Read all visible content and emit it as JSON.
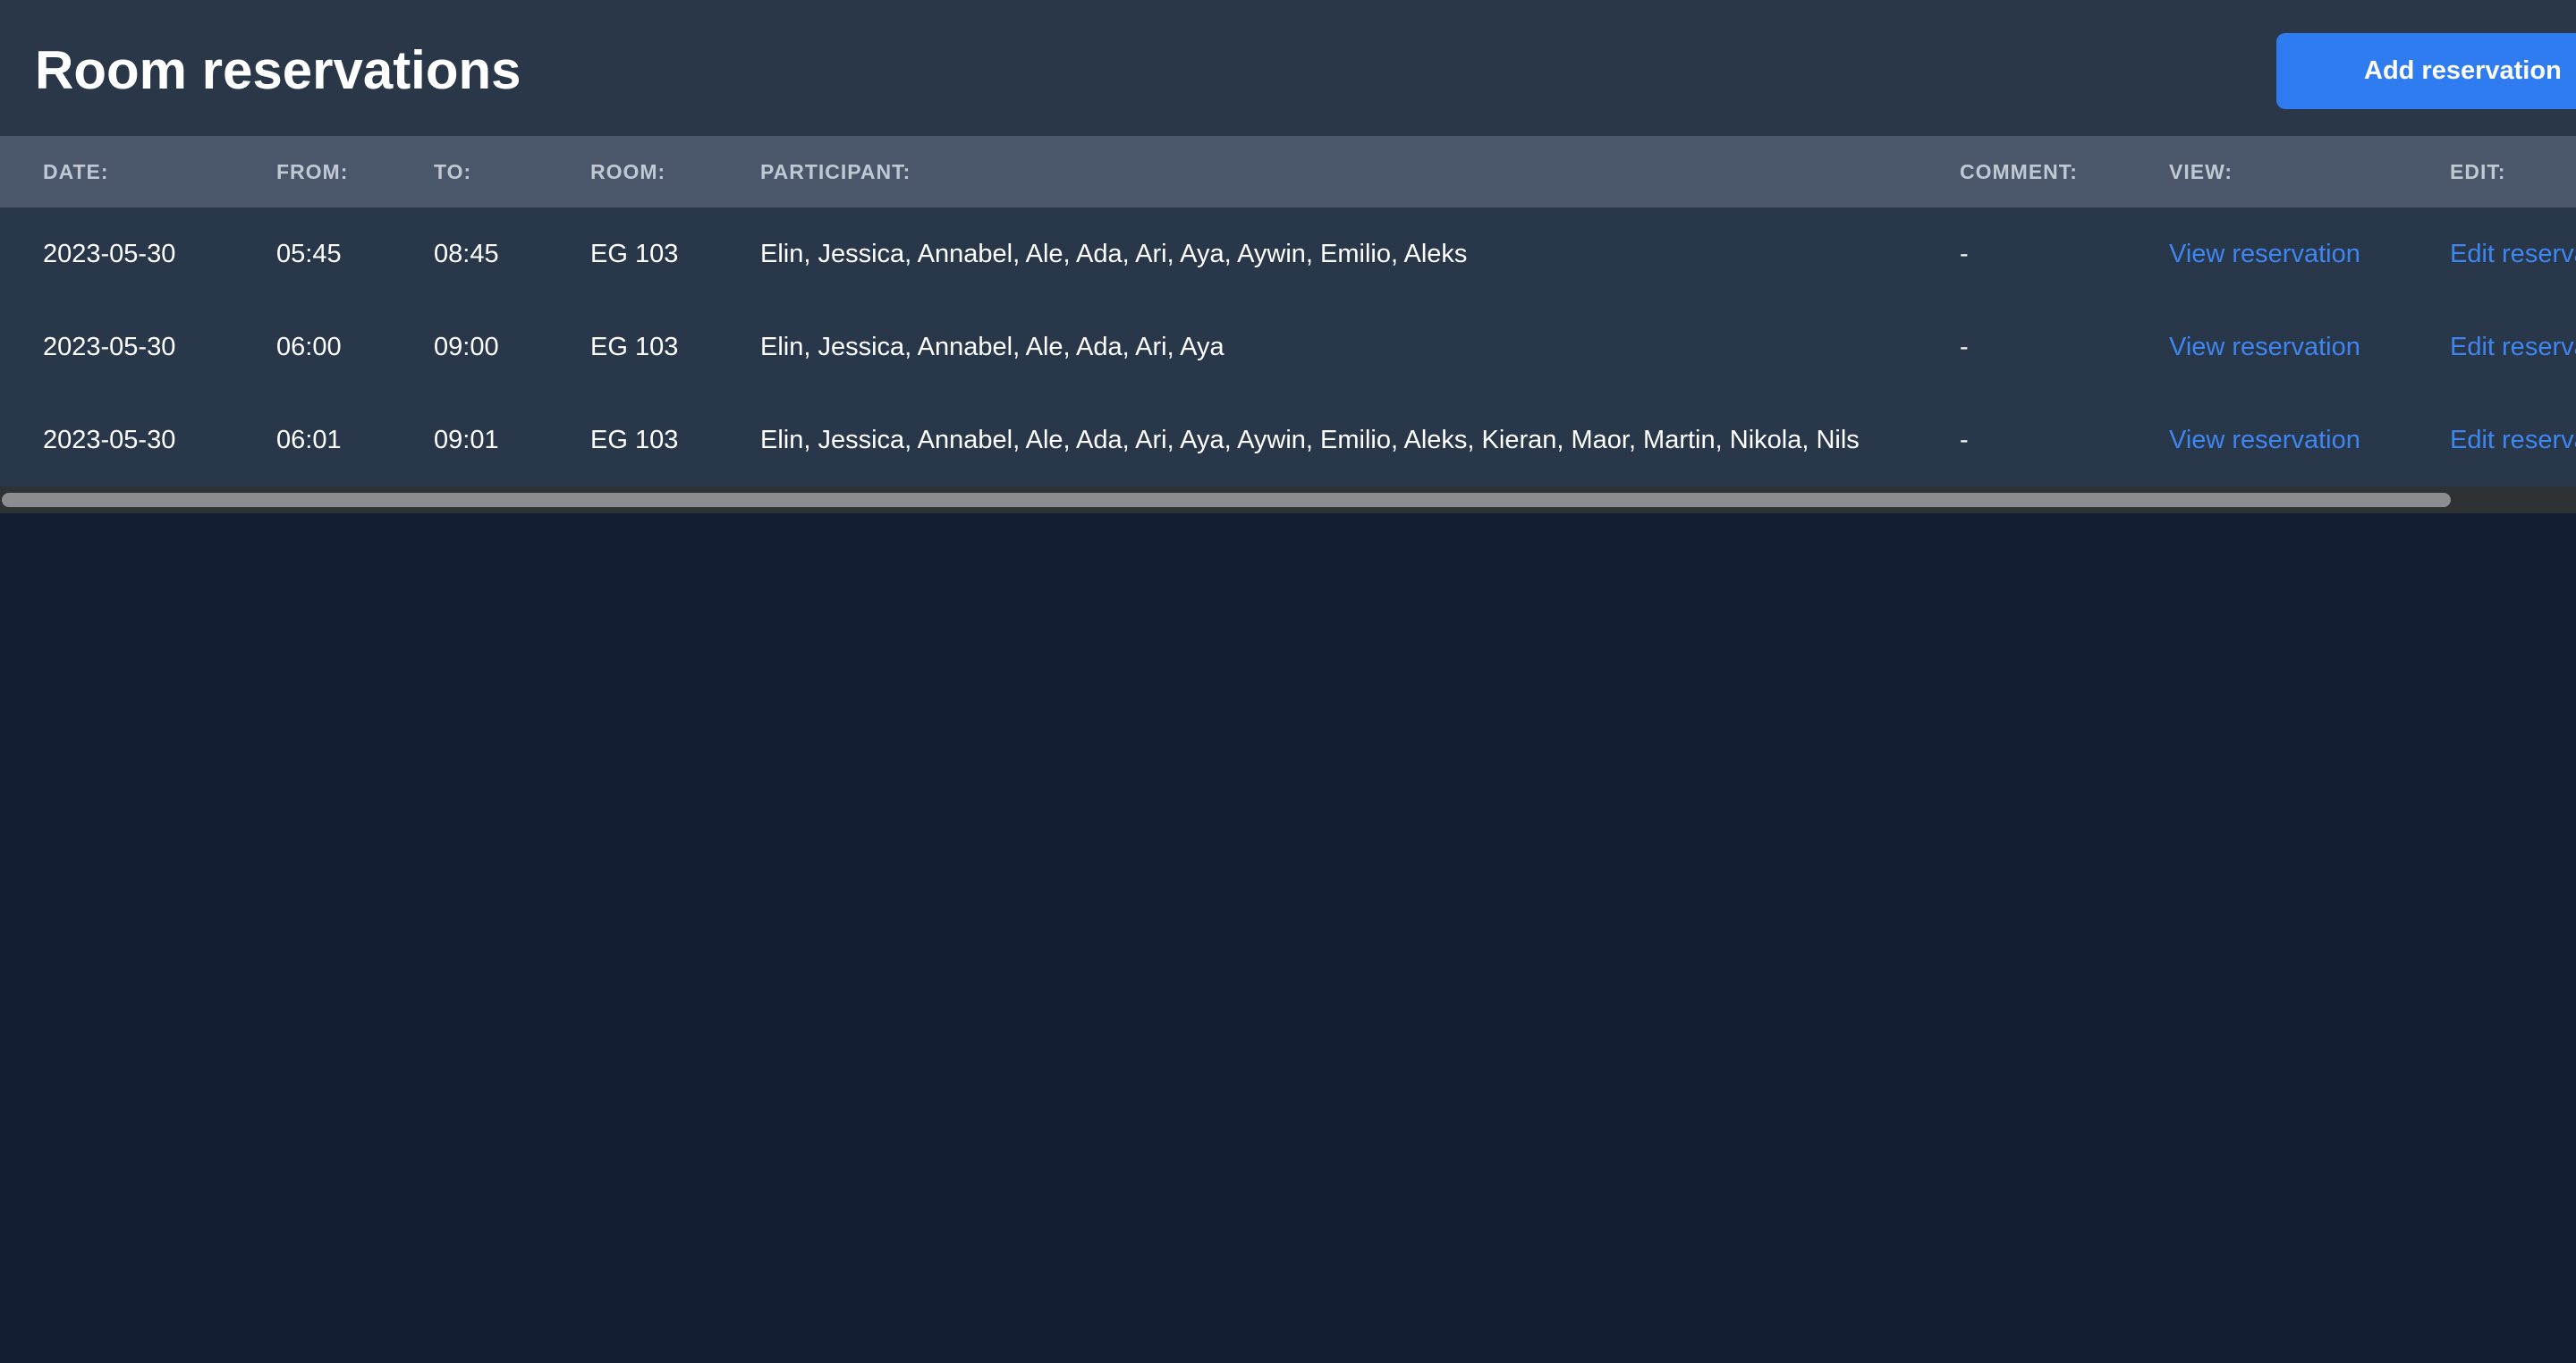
{
  "header": {
    "title": "Room reservations",
    "add_button_label": "Add reservation"
  },
  "table": {
    "columns": [
      "DATE:",
      "FROM:",
      "TO:",
      "ROOM:",
      "PARTICIPANT:",
      "COMMENT:",
      "VIEW:",
      "EDIT:"
    ],
    "rows": [
      {
        "date": "2023-05-30",
        "from": "05:45",
        "to": "08:45",
        "room": "EG 103",
        "participants": "Elin, Jessica, Annabel, Ale, Ada, Ari, Aya, Aywin, Emilio, Aleks",
        "comment": "-",
        "view": "View reservation",
        "edit": "Edit reservation"
      },
      {
        "date": "2023-05-30",
        "from": "06:00",
        "to": "09:00",
        "room": "EG 103",
        "participants": "Elin, Jessica, Annabel, Ale, Ada, Ari, Aya",
        "comment": "-",
        "view": "View reservation",
        "edit": "Edit reservation"
      },
      {
        "date": "2023-05-30",
        "from": "06:01",
        "to": "09:01",
        "room": "EG 103",
        "participants": "Elin, Jessica, Annabel, Ale, Ada, Ari, Aya, Aywin, Emilio, Aleks, Kieran, Maor, Martin, Nikola, Nils",
        "comment": "-",
        "view": "View reservation",
        "edit": "Edit reservation"
      }
    ]
  },
  "colors": {
    "page_background": "#141e33",
    "panel_background": "#29374b",
    "header_row_background": "#4a5669",
    "accent_button": "#2f7cf0",
    "link": "#3f86ef",
    "scrollbar_thumb": "#8b8d90"
  }
}
